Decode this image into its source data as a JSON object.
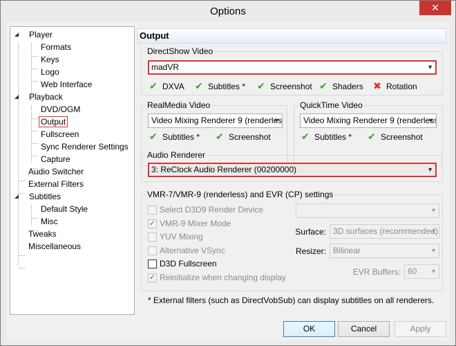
{
  "window": {
    "title": "Options",
    "close_label": "✕"
  },
  "tree": {
    "items": [
      {
        "label": "Player",
        "expanded": true
      },
      {
        "label": "Formats"
      },
      {
        "label": "Keys"
      },
      {
        "label": "Logo"
      },
      {
        "label": "Web Interface"
      },
      {
        "label": "Playback",
        "expanded": true
      },
      {
        "label": "DVD/OGM"
      },
      {
        "label": "Output",
        "selected": true
      },
      {
        "label": "Fullscreen"
      },
      {
        "label": "Sync Renderer Settings"
      },
      {
        "label": "Capture"
      },
      {
        "label": "Audio Switcher"
      },
      {
        "label": "External Filters"
      },
      {
        "label": "Subtitles",
        "expanded": true
      },
      {
        "label": "Default Style"
      },
      {
        "label": "Misc"
      },
      {
        "label": "Tweaks"
      },
      {
        "label": "Miscellaneous"
      }
    ]
  },
  "page": {
    "title": "Output"
  },
  "directshow": {
    "title": "DirectShow Video",
    "value": "madVR",
    "caps": [
      {
        "label": "DXVA",
        "ok": true
      },
      {
        "label": "Subtitles *",
        "ok": true
      },
      {
        "label": "Screenshot",
        "ok": true
      },
      {
        "label": "Shaders",
        "ok": true
      },
      {
        "label": "Rotation",
        "ok": false
      }
    ]
  },
  "realmedia": {
    "title": "RealMedia Video",
    "value": "Video Mixing Renderer 9 (renderless)",
    "caps": [
      {
        "label": "Subtitles *",
        "ok": true
      },
      {
        "label": "Screenshot",
        "ok": true
      }
    ]
  },
  "quicktime": {
    "title": "QuickTime Video",
    "value": "Video Mixing Renderer 9 (renderless)",
    "caps": [
      {
        "label": "Subtitles *",
        "ok": true
      },
      {
        "label": "Screenshot",
        "ok": true
      }
    ]
  },
  "audio": {
    "title": "Audio Renderer",
    "value": "3: ReClock Audio Renderer (00200000)"
  },
  "vmr": {
    "title": "VMR-7/VMR-9 (renderless) and EVR (CP) settings",
    "checks": [
      {
        "label": "Select D3D9 Render Device",
        "checked": false,
        "enabled": false
      },
      {
        "label": "VMR-9 Mixer Mode",
        "checked": true,
        "enabled": false
      },
      {
        "label": "YUV Mixing",
        "checked": false,
        "enabled": false
      },
      {
        "label": "Alternative VSync",
        "checked": false,
        "enabled": false
      },
      {
        "label": "D3D Fullscreen",
        "checked": false,
        "enabled": true
      },
      {
        "label": "Reinitialize when changing display",
        "checked": true,
        "enabled": false
      }
    ],
    "device_value": "",
    "surface_label": "Surface:",
    "surface_value": "3D surfaces (recommended)",
    "resizer_label": "Resizer:",
    "resizer_value": "Bilinear",
    "evr_label": "EVR Buffers:",
    "evr_value": "60"
  },
  "footnote": "* External filters (such as DirectVobSub) can display subtitles on all renderers.",
  "buttons": {
    "ok": "OK",
    "cancel": "Cancel",
    "apply": "Apply"
  },
  "icons": {
    "ok": "✔",
    "fail": "✖",
    "check": "✓",
    "combo_arrow": "▼",
    "tree_expanded": "◢"
  },
  "colors": {
    "highlight_border": "#d83535",
    "check_green": "#3d9c2d",
    "close_red": "#c7352e"
  }
}
